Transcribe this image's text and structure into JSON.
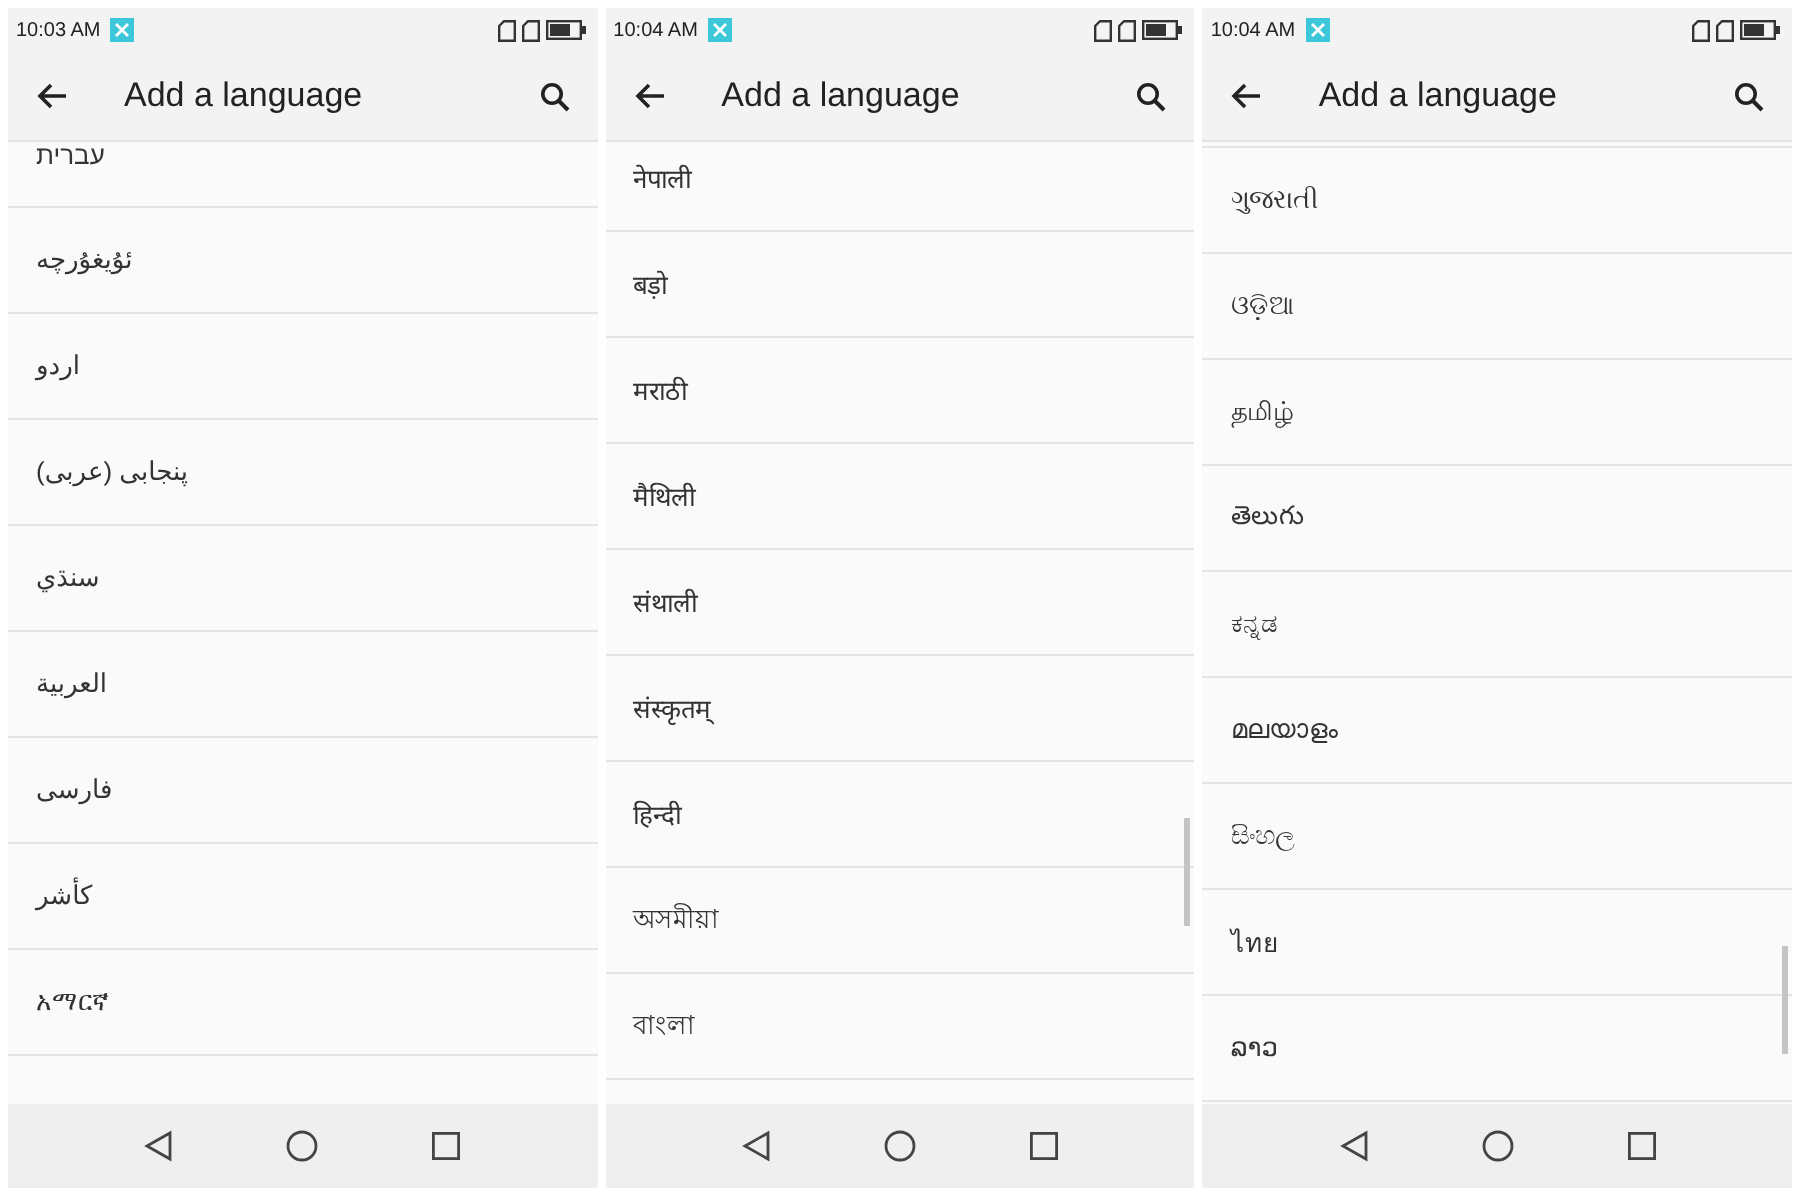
{
  "screens": [
    {
      "status_time": "10:03 AM",
      "title": "Add a language",
      "scrollbar": false,
      "languages": [
        "עברית",
        "ئۇيغۇرچە",
        "اردو",
        "پنجابی (عربی)",
        "سنڌي",
        "العربية",
        "فارسی",
        "کأشر",
        "አማርኛ"
      ]
    },
    {
      "status_time": "10:04 AM",
      "title": "Add a language",
      "scrollbar": true,
      "languages": [
        "नेपाली",
        "बड़ो",
        "मराठी",
        "मैथिली",
        "संथाली",
        "संस्कृतम्",
        "हिन्दी",
        "অসমীয়া",
        "বাংলা"
      ]
    },
    {
      "status_time": "10:04 AM",
      "title": "Add a language",
      "scrollbar": true,
      "languages": [
        "ગુજરાતી",
        "ଓଡ଼ିଆ",
        "தமிழ்",
        "తెలుగు",
        "ಕನ್ನಡ",
        "മലയാളം",
        "සිංහල",
        "ไทย",
        "ລາວ"
      ]
    }
  ]
}
